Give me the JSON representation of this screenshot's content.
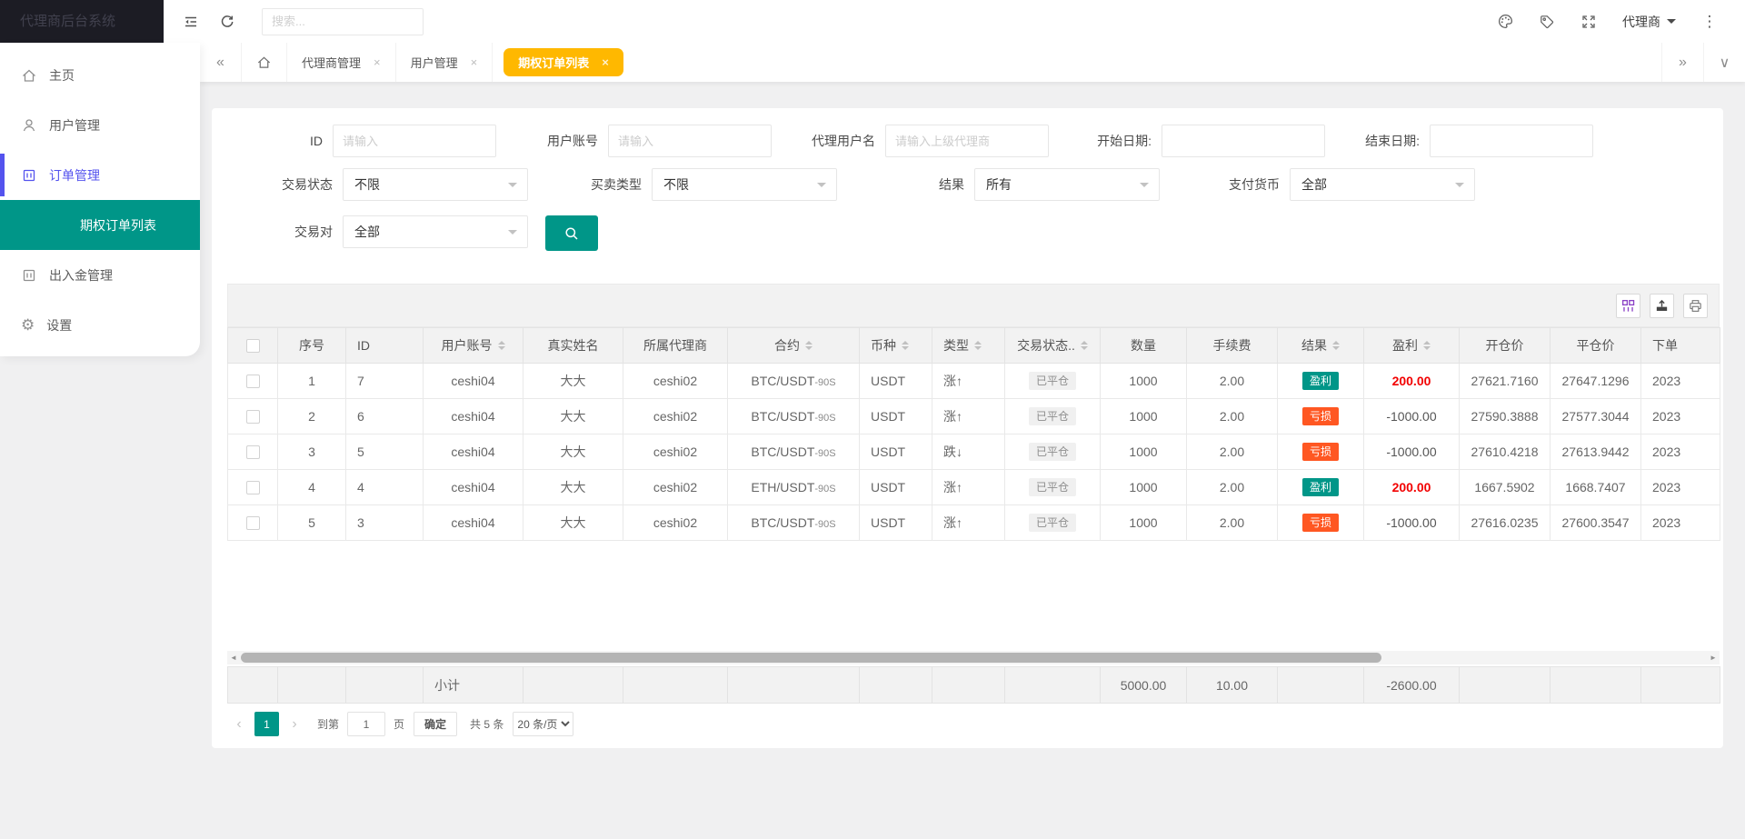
{
  "app": {
    "title": "代理商后台系统"
  },
  "topbar": {
    "search_placeholder": "搜索...",
    "user_label": "代理商"
  },
  "icons": {
    "more_vertical": "⋮",
    "gear": "⚙",
    "tabs_prev": "«",
    "tabs_next": "»",
    "tabs_collapse": "∨",
    "page_prev": "‹",
    "page_next": "›",
    "scroll_left": "◄",
    "scroll_right": "►",
    "close": "×"
  },
  "tabs": {
    "items": [
      {
        "label": "代理商管理",
        "active": false
      },
      {
        "label": "用户管理",
        "active": false
      },
      {
        "label": "期权订单列表",
        "active": true
      }
    ]
  },
  "sidebar": {
    "items": [
      {
        "label": "主页",
        "icon": "home-icon",
        "active": false
      },
      {
        "label": "用户管理",
        "icon": "user-icon",
        "active": false
      },
      {
        "label": "订单管理",
        "icon": "order-icon",
        "active": true
      },
      {
        "label": "出入金管理",
        "icon": "finance-icon",
        "active": false
      },
      {
        "label": "设置",
        "icon": "gear-icon",
        "active": false
      }
    ],
    "submenu": {
      "label": "期权订单列表",
      "active": true
    }
  },
  "filters": {
    "id_label": "ID",
    "id_placeholder": "请输入",
    "account_label": "用户账号",
    "account_placeholder": "请输入",
    "agent_label": "代理用户名",
    "agent_placeholder": "请输入上级代理商",
    "start_date_label": "开始日期:",
    "end_date_label": "结束日期:",
    "trade_status_label": "交易状态",
    "trade_status_value": "不限",
    "side_type_label": "买卖类型",
    "side_type_value": "不限",
    "result_label": "结果",
    "result_value": "所有",
    "pay_currency_label": "支付货币",
    "pay_currency_value": "全部",
    "pair_label": "交易对",
    "pair_value": "全部"
  },
  "table": {
    "columns": [
      {
        "label": "序号"
      },
      {
        "label": "ID"
      },
      {
        "label": "用户账号"
      },
      {
        "label": "真实姓名"
      },
      {
        "label": "所属代理商"
      },
      {
        "label": "合约"
      },
      {
        "label": "币种"
      },
      {
        "label": "类型"
      },
      {
        "label": "交易状态.."
      },
      {
        "label": "数量"
      },
      {
        "label": "手续费"
      },
      {
        "label": "结果"
      },
      {
        "label": "盈利"
      },
      {
        "label": "开仓价"
      },
      {
        "label": "平仓价"
      },
      {
        "label": "下单"
      }
    ],
    "rows": [
      {
        "index": "1",
        "id": "7",
        "account": "ceshi04",
        "real_name": "大大",
        "agent": "ceshi02",
        "contract": "BTC/USDT",
        "contract_period": "-90S",
        "coin": "USDT",
        "type": "涨↑",
        "status": "已平仓",
        "quantity": "1000",
        "fee": "2.00",
        "result": "盈利",
        "result_type": "win",
        "profit": "200.00",
        "open_price": "27621.7160",
        "close_price": "27647.1296",
        "order_time": "2023"
      },
      {
        "index": "2",
        "id": "6",
        "account": "ceshi04",
        "real_name": "大大",
        "agent": "ceshi02",
        "contract": "BTC/USDT",
        "contract_period": "-90S",
        "coin": "USDT",
        "type": "涨↑",
        "status": "已平仓",
        "quantity": "1000",
        "fee": "2.00",
        "result": "亏损",
        "result_type": "loss",
        "profit": "-1000.00",
        "open_price": "27590.3888",
        "close_price": "27577.3044",
        "order_time": "2023"
      },
      {
        "index": "3",
        "id": "5",
        "account": "ceshi04",
        "real_name": "大大",
        "agent": "ceshi02",
        "contract": "BTC/USDT",
        "contract_period": "-90S",
        "coin": "USDT",
        "type": "跌↓",
        "status": "已平仓",
        "quantity": "1000",
        "fee": "2.00",
        "result": "亏损",
        "result_type": "loss",
        "profit": "-1000.00",
        "open_price": "27610.4218",
        "close_price": "27613.9442",
        "order_time": "2023"
      },
      {
        "index": "4",
        "id": "4",
        "account": "ceshi04",
        "real_name": "大大",
        "agent": "ceshi02",
        "contract": "ETH/USDT",
        "contract_period": "-90S",
        "coin": "USDT",
        "type": "涨↑",
        "status": "已平仓",
        "quantity": "1000",
        "fee": "2.00",
        "result": "盈利",
        "result_type": "win",
        "profit": "200.00",
        "open_price": "1667.5902",
        "close_price": "1668.7407",
        "order_time": "2023"
      },
      {
        "index": "5",
        "id": "3",
        "account": "ceshi04",
        "real_name": "大大",
        "agent": "ceshi02",
        "contract": "BTC/USDT",
        "contract_period": "-90S",
        "coin": "USDT",
        "type": "涨↑",
        "status": "已平仓",
        "quantity": "1000",
        "fee": "2.00",
        "result": "亏损",
        "result_type": "loss",
        "profit": "-1000.00",
        "open_price": "27616.0235",
        "close_price": "27600.3547",
        "order_time": "2023"
      }
    ],
    "summary": {
      "label": "小计",
      "quantity": "5000.00",
      "fee": "10.00",
      "profit": "-2600.00"
    }
  },
  "pagination": {
    "current": "1",
    "goto_label": "到第",
    "goto_value": "1",
    "page_label": "页",
    "confirm_label": "确定",
    "total_label": "共 5 条",
    "size_label": "20 条/页"
  },
  "colors": {
    "teal": "#009688",
    "orange": "#ff5722",
    "yellow": "#ffb800",
    "purple": "#5453ee",
    "profit_red": "#f20000"
  }
}
